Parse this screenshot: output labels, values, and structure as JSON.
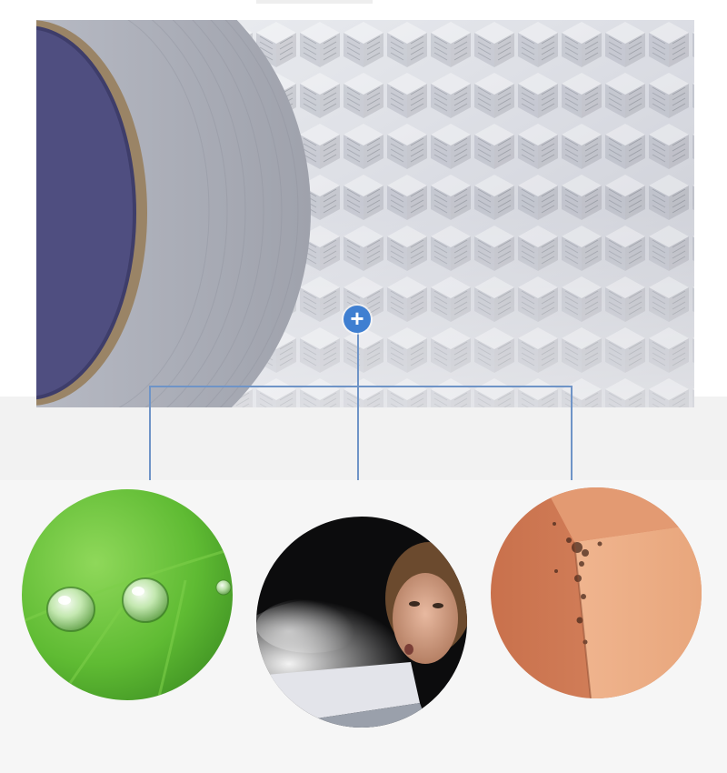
{
  "hero": {
    "subject": "aluminum-foil-tape-roll",
    "pattern": "embossed-cube-diamond",
    "colors": {
      "foil_light": "#e9eaee",
      "foil_dark": "#b9bcc6",
      "core_inner": "#4f4e80",
      "core_ring": "#9a8466"
    }
  },
  "hotspot": {
    "icon": "plus-icon",
    "color": "#3f7fd1"
  },
  "connectors": {
    "color": "#6f94c7"
  },
  "features": [
    {
      "id": "waterproof",
      "icon": "water-droplets-on-leaf",
      "accent": "#59b733"
    },
    {
      "id": "dustproof",
      "icon": "person-blowing-dust",
      "accent": "#1a1a1a"
    },
    {
      "id": "mold-proof",
      "icon": "moldy-wall-corner",
      "accent": "#d4896a"
    }
  ]
}
